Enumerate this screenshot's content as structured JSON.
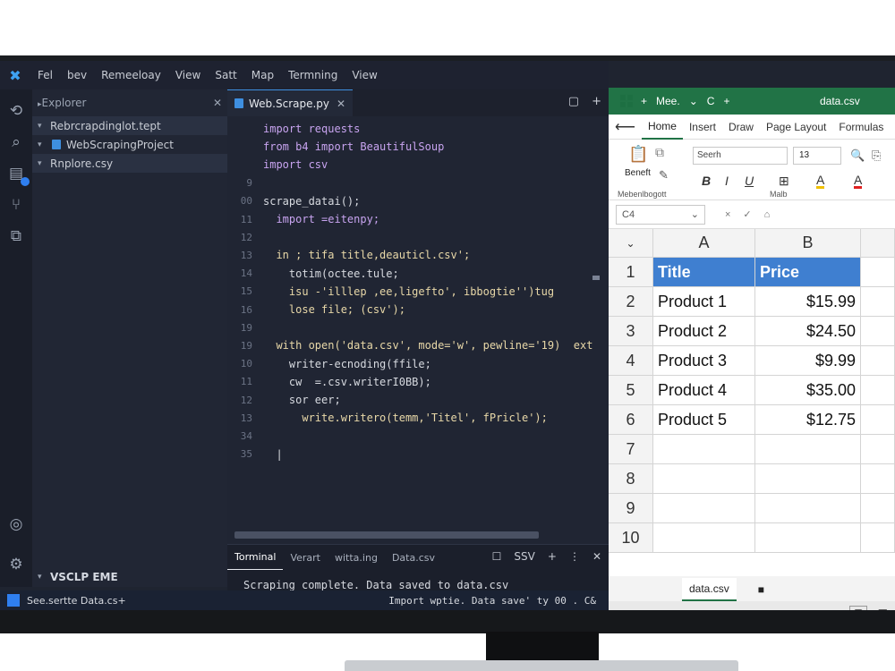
{
  "vscode": {
    "menu": [
      "Fel",
      "bev",
      "Remeeloay",
      "View",
      "Satt",
      "Map",
      "Termning",
      "View"
    ],
    "explorer_title": "Explorer",
    "tree": [
      {
        "label": "Rebrcrapdinglot.tept"
      },
      {
        "label": "WebScrapingProject"
      },
      {
        "label": "Rnplore.csy"
      }
    ],
    "outline_label": "VSCLP EME",
    "tab_label": "Web.Scrape.py",
    "code_lines": [
      {
        "ln": "",
        "text": "import requests"
      },
      {
        "ln": "",
        "text": "from b4 import BeautifulSoup"
      },
      {
        "ln": "",
        "text": "import csv"
      },
      {
        "ln": "9",
        "text": ""
      },
      {
        "ln": "00",
        "text": "scrape_datai();"
      },
      {
        "ln": "11",
        "text": "  import =eitenpy;"
      },
      {
        "ln": "12",
        "text": ""
      },
      {
        "ln": "13",
        "text": "  in ; tifa title,deauticl.csv';"
      },
      {
        "ln": "14",
        "text": "    totim(octee.tule;"
      },
      {
        "ln": "15",
        "text": "    isu -'illlep ,ee,ligefto', ibbogtie'')tug"
      },
      {
        "ln": "16",
        "text": "    lose file; (csv');"
      },
      {
        "ln": "19",
        "text": ""
      },
      {
        "ln": "19",
        "text": "  with open('data.csv', mode='w', pewline='19)  ext"
      },
      {
        "ln": "10",
        "text": "    writer-ecnoding(ffile;"
      },
      {
        "ln": "11",
        "text": "    cw  =.csv.writerI0BB);"
      },
      {
        "ln": "12",
        "text": "    sor eer;"
      },
      {
        "ln": "13",
        "text": "      write.writero(temm,'Titel', fPricle');"
      },
      {
        "ln": "34",
        "text": ""
      },
      {
        "ln": "35",
        "text": "  |"
      }
    ],
    "terminal_tabs": [
      "Torminal",
      "Verart",
      "witta.ing",
      "Data.csv"
    ],
    "terminal_ssv": "SSV",
    "terminal_output": "Scraping complete. Data saved to data.csv",
    "status_left": "See.sertte Data.cs+",
    "status_right": "Import wptie. Data save' ty  00 . C&"
  },
  "excel": {
    "title_items": [
      "Mee.",
      "C"
    ],
    "doc_title": "data.csv",
    "ribbon_tabs": [
      "Home",
      "Insert",
      "Draw",
      "Page Layout",
      "Formulas"
    ],
    "active_tab": "Home",
    "font_name": "Seerh",
    "font_size": "13",
    "paste_label": "Beneft",
    "clipboard_label": "Mebenlbogott",
    "font_group_label": "Malb",
    "name_box": "C4",
    "col_headers": [
      "A",
      "B"
    ],
    "row_numbers": [
      "1",
      "2",
      "3",
      "4",
      "5",
      "6",
      "7",
      "8",
      "9",
      "10"
    ],
    "header_row": [
      "Title",
      "Price"
    ],
    "rows": [
      [
        "Product 1",
        "$15.99"
      ],
      [
        "Product 2",
        "$24.50"
      ],
      [
        "Product 3",
        "$9.99"
      ],
      [
        "Product 4",
        "$35.00"
      ],
      [
        "Product 5",
        "$12.75"
      ]
    ],
    "sheet_tab": "data.csv",
    "colors": {
      "green": "#217346",
      "header_fill": "#3f7fd0"
    }
  }
}
